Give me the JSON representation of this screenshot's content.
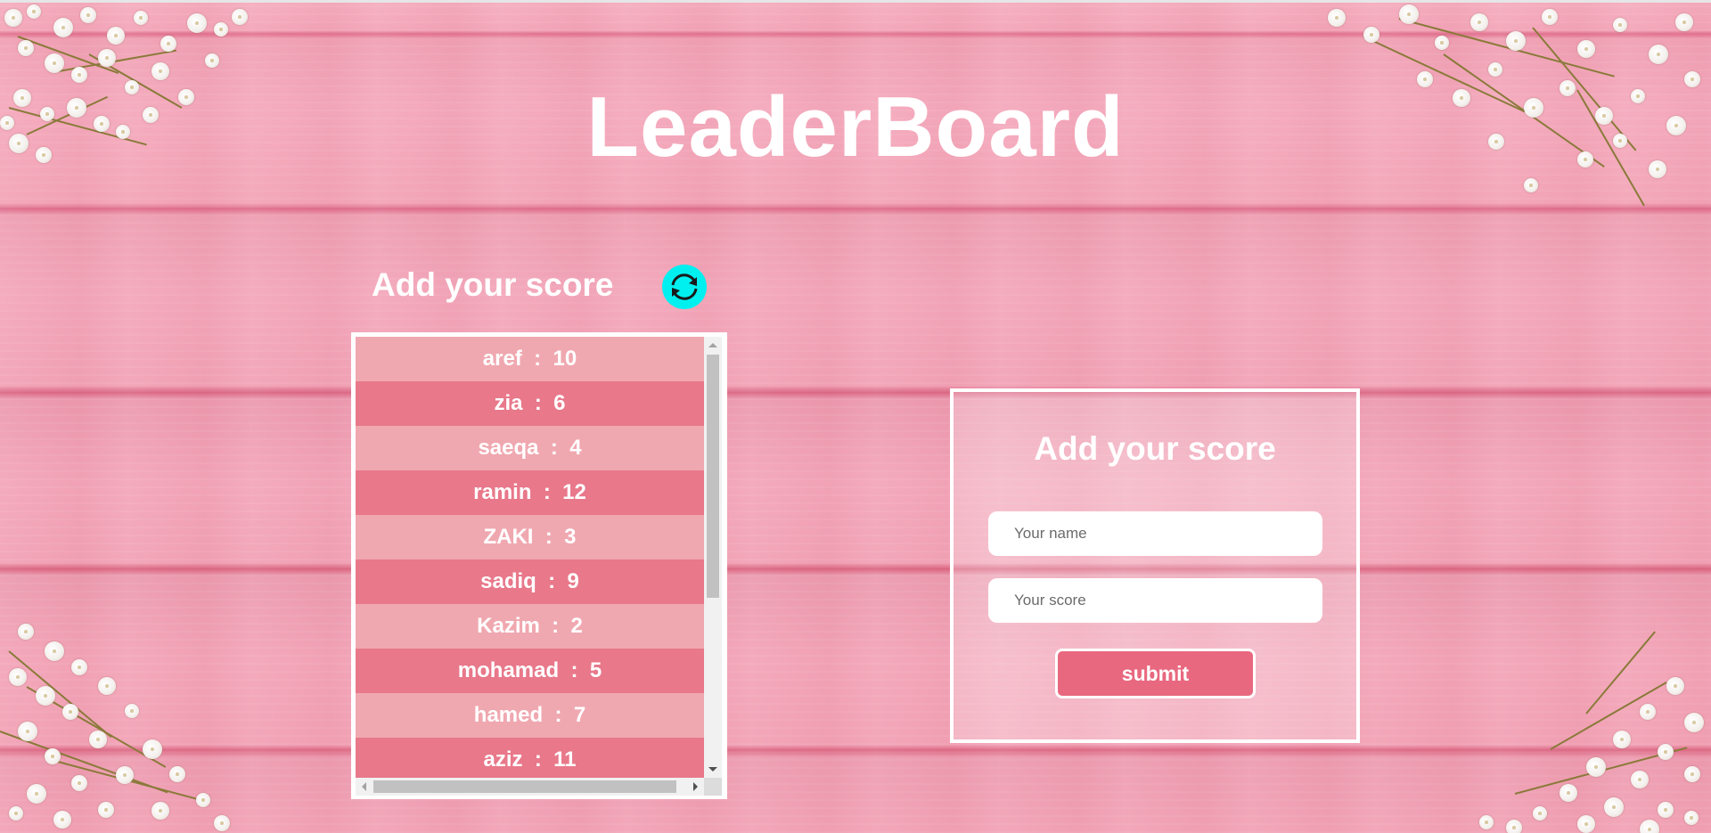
{
  "page": {
    "title": "LeaderBoard"
  },
  "scores_section": {
    "heading": "Add your score",
    "refresh_icon": "refresh-icon",
    "entries": [
      {
        "name": "aref",
        "score": 10
      },
      {
        "name": "zia",
        "score": 6
      },
      {
        "name": "saeqa",
        "score": 4
      },
      {
        "name": "ramin",
        "score": 12
      },
      {
        "name": "ZAKI",
        "score": 3
      },
      {
        "name": "sadiq",
        "score": 9
      },
      {
        "name": "Kazim",
        "score": 2
      },
      {
        "name": "mohamad",
        "score": 5
      },
      {
        "name": "hamed",
        "score": 7
      },
      {
        "name": "aziz",
        "score": 11
      }
    ]
  },
  "form": {
    "heading": "Add your score",
    "name_placeholder": "Your name",
    "name_value": "",
    "score_placeholder": "Your score",
    "score_value": "",
    "submit_label": "submit"
  },
  "colors": {
    "background": "#f29bb1",
    "row_light": "#f0a8b0",
    "row_dark": "#e8788a",
    "refresh_button": "#00f0f0",
    "submit_button": "#e8687f",
    "text": "#ffffff"
  }
}
